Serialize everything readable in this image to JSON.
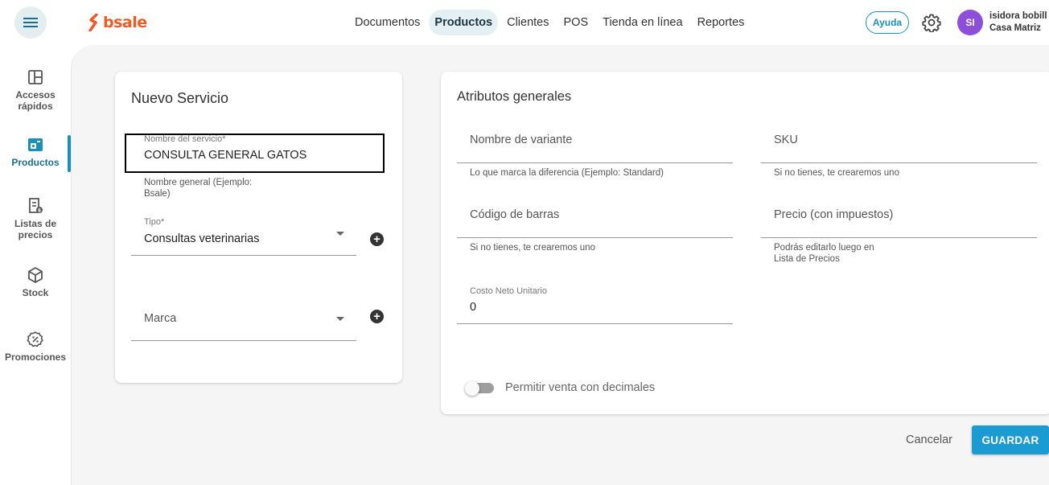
{
  "header": {
    "brand": "bsale",
    "nav": [
      {
        "label": "Documentos",
        "active": false
      },
      {
        "label": "Productos",
        "active": true
      },
      {
        "label": "Clientes",
        "active": false
      },
      {
        "label": "POS",
        "active": false
      },
      {
        "label": "Tienda en línea",
        "active": false
      },
      {
        "label": "Reportes",
        "active": false
      }
    ],
    "help_label": "Ayuda",
    "avatar_initials": "SI",
    "user_name": "isidora bobill",
    "user_branch": "Casa Matriz"
  },
  "sidebar": {
    "items": [
      {
        "label": "Accesos rápidos",
        "icon": "layout-grid-icon",
        "active": false
      },
      {
        "label": "Productos",
        "icon": "product-tag-icon",
        "active": true
      },
      {
        "label": "Listas de precios",
        "icon": "price-list-icon",
        "active": false
      },
      {
        "label": "Stock",
        "icon": "cube-icon",
        "active": false
      },
      {
        "label": "Promociones",
        "icon": "discount-badge-icon",
        "active": false
      }
    ]
  },
  "left_card": {
    "title": "Nuevo Servicio",
    "service_name_label": "Nombre del servicio*",
    "service_name_value": "CONSULTA GENERAL GATOS",
    "service_name_hint": "Nombre general (Ejemplo: Bsale)",
    "tipo_label": "Tipo*",
    "tipo_value": "Consultas veterinarias",
    "marca_placeholder": "Marca"
  },
  "right_card": {
    "title": "Atributos generales",
    "variant_name_placeholder": "Nombre de variante",
    "variant_name_hint": "Lo que marca la diferencia (Ejemplo: Standard)",
    "sku_placeholder": "SKU",
    "sku_hint": "Si no tienes, te crearemos uno",
    "barcode_placeholder": "Código de barras",
    "barcode_hint": "Si no tienes, te crearemos uno",
    "price_placeholder": "Precio (con impuestos)",
    "price_hint": "Podrás editarlo luego en Lista de Precios",
    "cost_label": "Costo Neto Unitario",
    "cost_value": "0",
    "decimals_toggle_label": "Permitir venta con decimales",
    "decimals_enabled": false
  },
  "footer": {
    "cancel_label": "Cancelar",
    "save_label": "GUARDAR"
  },
  "colors": {
    "brand_orange": "#f15a22",
    "accent_blue": "#1a9bd1",
    "avatar_purple": "#8c4fd9"
  }
}
